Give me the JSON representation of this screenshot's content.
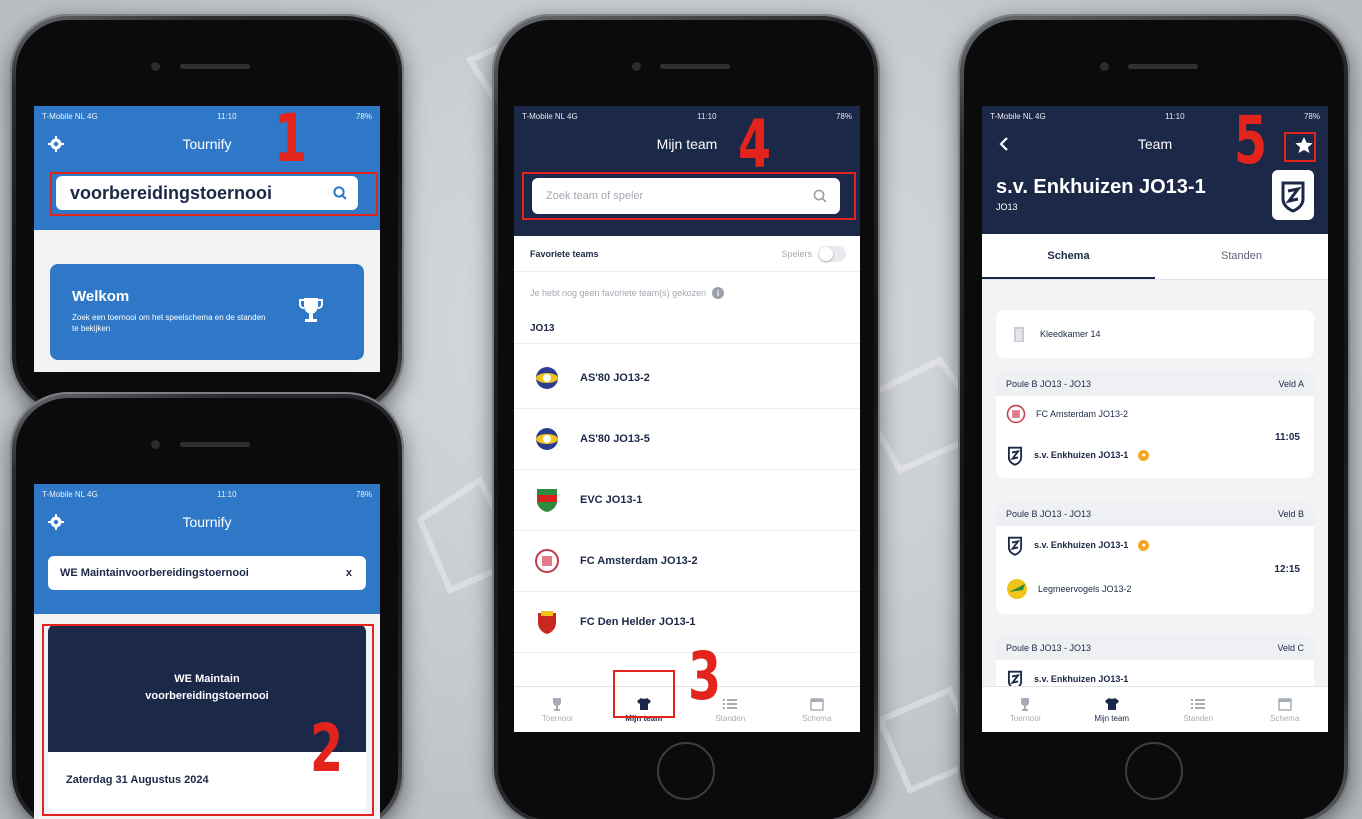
{
  "status": {
    "carrier": "T-Mobile NL 4G",
    "battery": "78%"
  },
  "phone1": {
    "time": "11:10",
    "title": "Tournify",
    "search_value": "voorbereidingstoernooi",
    "welcome_title": "Welkom",
    "welcome_text": "Zoek een toernooi om het speelschema en de standen te bekijken",
    "step": "1"
  },
  "phone2": {
    "time": "11:10",
    "title": "Tournify",
    "search_value": "WE Maintainvoorbereidingstoernooi",
    "clear_label": "x",
    "tournament_name": "WE Maintain voorbereidingstoernooi",
    "tournament_date": "Zaterdag 31 Augustus 2024",
    "step": "2"
  },
  "phone3": {
    "time": "11:10",
    "title": "Mijn team",
    "search_placeholder": "Zoek team of speler",
    "fav_label": "Favoriete teams",
    "players_label": "Spelers",
    "empty_text": "Je hebt nog geen favoriete team(s) gekozen",
    "group": "JO13",
    "teams": [
      "AS'80 JO13-2",
      "AS'80 JO13-5",
      "EVC JO13-1",
      "FC Amsterdam JO13-2",
      "FC Den Helder JO13-1"
    ],
    "tabs": [
      "Toernooi",
      "Mijn team",
      "Standen",
      "Schema"
    ],
    "step_tab": "3",
    "step_search": "4"
  },
  "phone4": {
    "time": "11:10",
    "title": "Team",
    "team_name": "s.v. Enkhuizen JO13-1",
    "team_sub": "JO13",
    "tab_schema": "Schema",
    "tab_standen": "Standen",
    "locker": "Kleedkamer 14",
    "matches": [
      {
        "poule": "Poule B JO13 - JO13",
        "field": "Veld A",
        "home": "FC Amsterdam JO13-2",
        "away": "s.v. Enkhuizen JO13-1",
        "time": "11:05"
      },
      {
        "poule": "Poule B JO13 - JO13",
        "field": "Veld B",
        "home": "s.v. Enkhuizen JO13-1",
        "away": "Legmeervogels JO13-2",
        "time": "12:15"
      },
      {
        "poule": "Poule B JO13 - JO13",
        "field": "Veld C",
        "home": "s.v. Enkhuizen JO13-1",
        "away": "",
        "time": ""
      }
    ],
    "tabs": [
      "Toernooi",
      "Mijn team",
      "Standen",
      "Schema"
    ],
    "step": "5"
  },
  "colors": {
    "brand_blue": "#2e78c7",
    "navy": "#1c2848",
    "highlight_red": "#e3241d",
    "captain_orange": "#f5a623"
  }
}
